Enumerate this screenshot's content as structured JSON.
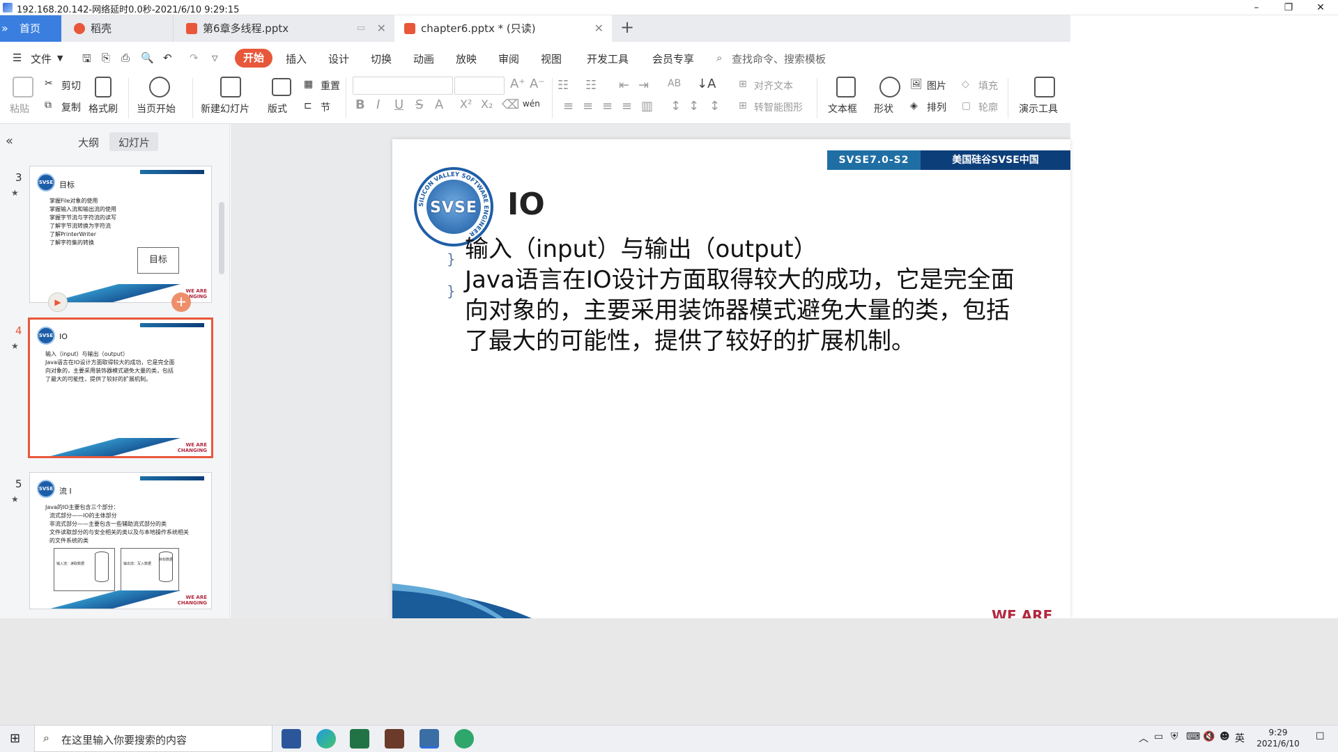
{
  "remote": {
    "title": "192.168.20.142-网络延时0.0秒-2021/6/10 9:29:15",
    "minimize": "–",
    "restore": "❐",
    "close": "✕"
  },
  "tabs": [
    {
      "label": "首页"
    },
    {
      "label": "稻壳"
    },
    {
      "label": "第6章多线程.pptx"
    },
    {
      "label": "chapter6.pptx * (只读)"
    }
  ],
  "tab_add": "+",
  "menu": {
    "file": "文件",
    "items": [
      "开始",
      "插入",
      "设计",
      "切换",
      "动画",
      "放映",
      "审阅",
      "视图",
      "开发工具",
      "会员专享"
    ],
    "search_placeholder": "查找命令、搜索模板"
  },
  "ribbon": {
    "paste": "粘贴",
    "cut": "剪切",
    "copy": "复制",
    "format_painter": "格式刷",
    "from_current": "当页开始",
    "new_slide": "新建幻灯片",
    "layout": "版式",
    "reset": "重置",
    "section": "节",
    "align_text": "对齐文本",
    "smart_art": "转智能图形",
    "textbox": "文本框",
    "shape": "形状",
    "picture": "图片",
    "arrange": "排列",
    "fill": "填充",
    "outline": "轮廓",
    "presentation_tools": "演示工具",
    "font_bold": "B",
    "font_italic": "I",
    "font_underline": "U",
    "font_strike": "S",
    "font_color": "A",
    "sup": "X²",
    "sub": "X₂",
    "grow": "A⁺",
    "shrink": "A⁻",
    "wen": "wén"
  },
  "left_panel": {
    "tabs": [
      "大纲",
      "幻灯片"
    ],
    "collapse": "«",
    "slides": [
      {
        "num": "3",
        "title": "目标",
        "lines": [
          "掌握File对象的使用",
          "掌握输入流和输出流的使用",
          "掌握字节流与字符流的读写",
          "了解字节流转换为字符流",
          "了解PrinterWriter",
          "了解字符集的转换"
        ],
        "box_label": "目标"
      },
      {
        "num": "4",
        "title": "IO",
        "lines": [
          "输入（input）与输出（output）",
          "Java语言在IO设计方面取得较大的成功，它是完全面",
          "向对象的，主要采用装饰器模式避免大量的类，包括",
          "了最大的可能性，提供了较好的扩展机制。"
        ]
      },
      {
        "num": "5",
        "title": "流 I",
        "lines": [
          "Java的IO主要包含三个部分：",
          "流式部分——IO的主体部分",
          "非流式部分——主要包含一些辅助流式部分的类",
          "文件读取部分的与安全相关的类以及与本地操作系统相关",
          "的文件系统的类"
        ],
        "box_a": "输入流：读取数据",
        "box_b": "输出流：写入数据",
        "box_c": "目标数据"
      }
    ],
    "we_are": "WE ARE",
    "changing": "CHANGING"
  },
  "slide": {
    "banner_left": "SVSE7.0-S2",
    "banner_right": "美国硅谷SVSE中国",
    "logo_text": "SVSE",
    "logo_ring": "SILICON VALLEY SOFTWARE ENGINEER",
    "title": "IO",
    "bullets": [
      "输入（input）与输出（output）",
      "Java语言在IO设计方面取得较大的成功，它是完全面",
      "向对象的，主要采用装饰器模式避免大量的类，包括",
      "了最大的可能性，提供了较好的扩展机制。"
    ],
    "bullet_glyph": "}",
    "footer_text": "WE ARE"
  },
  "taskbar": {
    "search_placeholder": "在这里输入你要搜索的内容",
    "ime": "英",
    "time": "9:29",
    "date": "2021/6/10"
  },
  "colors": {
    "accent": "#e8573a",
    "slide_blue": "#1f6fa5",
    "slide_navy": "#0c3e7a",
    "home_tab": "#3a7fe0"
  }
}
